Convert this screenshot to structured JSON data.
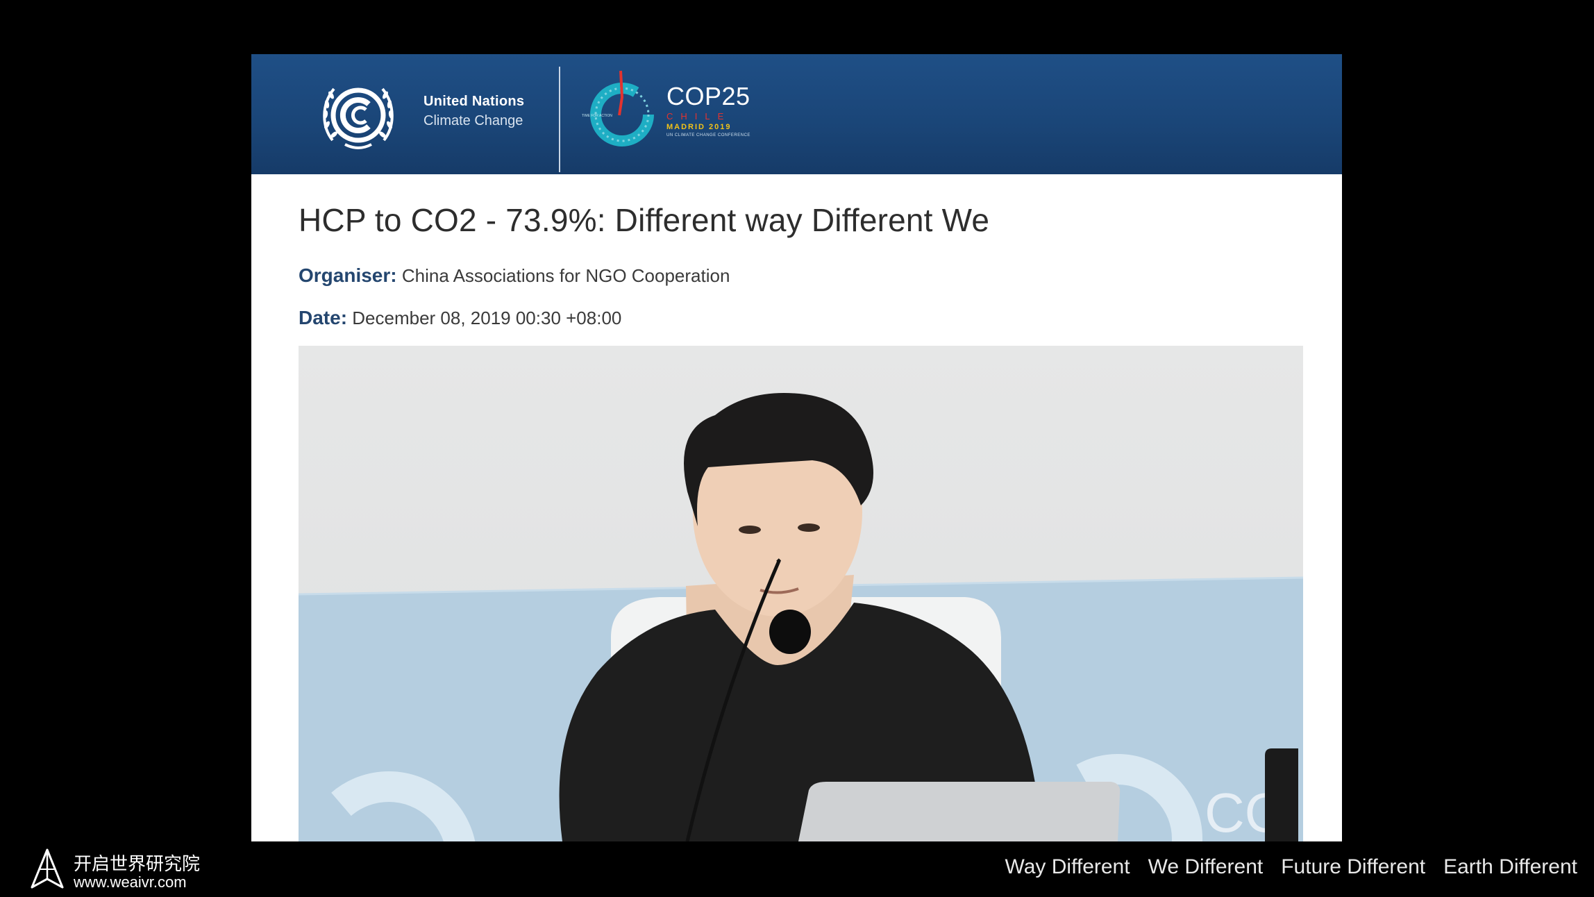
{
  "banner": {
    "un_line1": "United Nations",
    "un_line2": "Climate Change",
    "cop_title": "COP25",
    "cop_country": "CHILE",
    "cop_city": "MADRID 2019",
    "cop_sub": "UN CLIMATE CHANGE CONFERENCE",
    "cop_ring_text": "TIME FOR ACTION",
    "colors": {
      "banner": "#1a4577",
      "cop_ring": "#1eaec4",
      "chile_red": "#e2332f",
      "madrid_yellow": "#f2c317"
    }
  },
  "event": {
    "title": "HCP to CO2 - 73.9%: Different way Different We",
    "organiser_label": "Organiser:",
    "organiser_value": "China Associations for NGO Cooperation",
    "date_label": "Date:",
    "date_value": "December 08, 2019 00:30 +08:00"
  },
  "video": {
    "backdrop_text": "CO"
  },
  "footer": {
    "org_name_cn": "开启世界研究院",
    "org_url": "www.weaivr.com",
    "slogans": [
      "Way Different",
      "We Different",
      "Future Different",
      "Earth Different"
    ]
  }
}
